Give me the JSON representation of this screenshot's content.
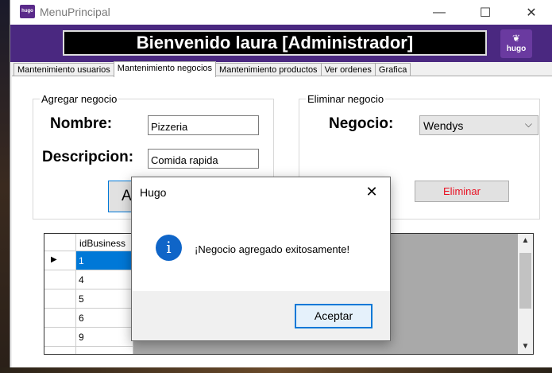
{
  "window": {
    "title": "MenuPrincipal",
    "minimize_glyph": "—",
    "maximize_glyph": "☐",
    "close_glyph": "✕"
  },
  "header": {
    "banner": "Bienvenido laura [Administrador]",
    "logo_text": "hugo",
    "logo_icon": "leaf-emblem-icon"
  },
  "tabs": [
    {
      "label": "Mantenimiento usuarios"
    },
    {
      "label": "Mantenimiento negocios"
    },
    {
      "label": "Mantenimiento productos"
    },
    {
      "label": "Ver ordenes"
    },
    {
      "label": "Grafica"
    }
  ],
  "add_group": {
    "title": "Agregar negocio",
    "name_label": "Nombre:",
    "name_value": "Pizzeria",
    "desc_label": "Descripcion:",
    "desc_value": "Comida rapida",
    "add_button_visible": "A"
  },
  "delete_group": {
    "title": "Eliminar negocio",
    "business_label": "Negocio:",
    "business_value": "Wendys",
    "delete_button": "Eliminar",
    "delete_color": "#e81123"
  },
  "grid": {
    "columns": [
      "idBusiness"
    ],
    "rows": [
      {
        "id": "1",
        "selected": true
      },
      {
        "id": "4",
        "selected": false
      },
      {
        "id": "5",
        "selected": false
      },
      {
        "id": "6",
        "selected": false
      },
      {
        "id": "9",
        "selected": false
      }
    ],
    "current_row_marker": "▶",
    "scroll_up": "▲",
    "scroll_down": "▼"
  },
  "dialog": {
    "title": "Hugo",
    "message": "¡Negocio agregado exitosamente!",
    "ok_button": "Aceptar",
    "close_glyph": "✕",
    "icon": "info-icon",
    "icon_glyph": "i",
    "icon_color": "#0f65c8"
  },
  "colors": {
    "header_bg": "#4a2880",
    "selection": "#0078d7"
  }
}
